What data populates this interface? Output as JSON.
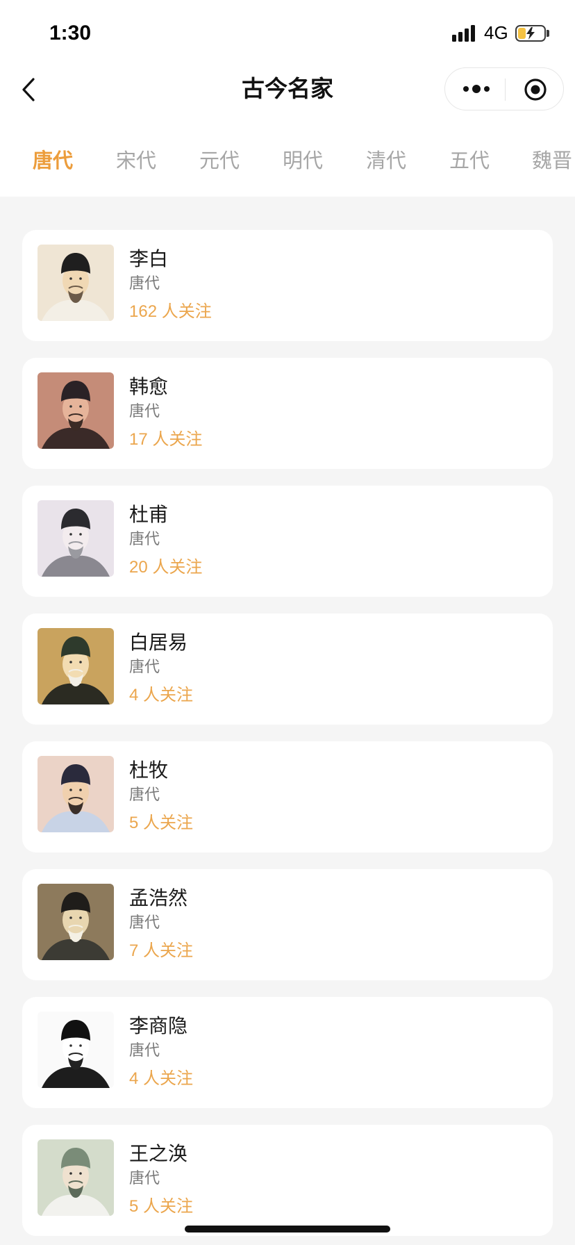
{
  "status_bar": {
    "time": "1:30",
    "network": "4G",
    "battery_level": 0.3,
    "signal_icon": "cellular-signal-icon",
    "battery_icon": "battery-charging-icon"
  },
  "nav": {
    "title": "古今名家",
    "back_icon": "chevron-left-icon",
    "more_icon": "more-dots-icon",
    "close_icon": "target-icon"
  },
  "tabs": [
    {
      "label": "唐代",
      "active": true
    },
    {
      "label": "宋代",
      "active": false
    },
    {
      "label": "元代",
      "active": false
    },
    {
      "label": "明代",
      "active": false
    },
    {
      "label": "清代",
      "active": false
    },
    {
      "label": "五代",
      "active": false
    },
    {
      "label": "魏晋",
      "active": false
    }
  ],
  "poets": [
    {
      "name": "李白",
      "dynasty": "唐代",
      "followers": "162 人关注"
    },
    {
      "name": "韩愈",
      "dynasty": "唐代",
      "followers": "17 人关注"
    },
    {
      "name": "杜甫",
      "dynasty": "唐代",
      "followers": "20 人关注"
    },
    {
      "name": "白居易",
      "dynasty": "唐代",
      "followers": "4 人关注"
    },
    {
      "name": "杜牧",
      "dynasty": "唐代",
      "followers": "5 人关注"
    },
    {
      "name": "孟浩然",
      "dynasty": "唐代",
      "followers": "7 人关注"
    },
    {
      "name": "李商隐",
      "dynasty": "唐代",
      "followers": "4 人关注"
    },
    {
      "name": "王之涣",
      "dynasty": "唐代",
      "followers": "5 人关注"
    }
  ],
  "colors": {
    "accent": "#ec9d3c",
    "followers": "#eba64d",
    "page_bg": "#f5f5f5",
    "battery": "#f5c242"
  }
}
